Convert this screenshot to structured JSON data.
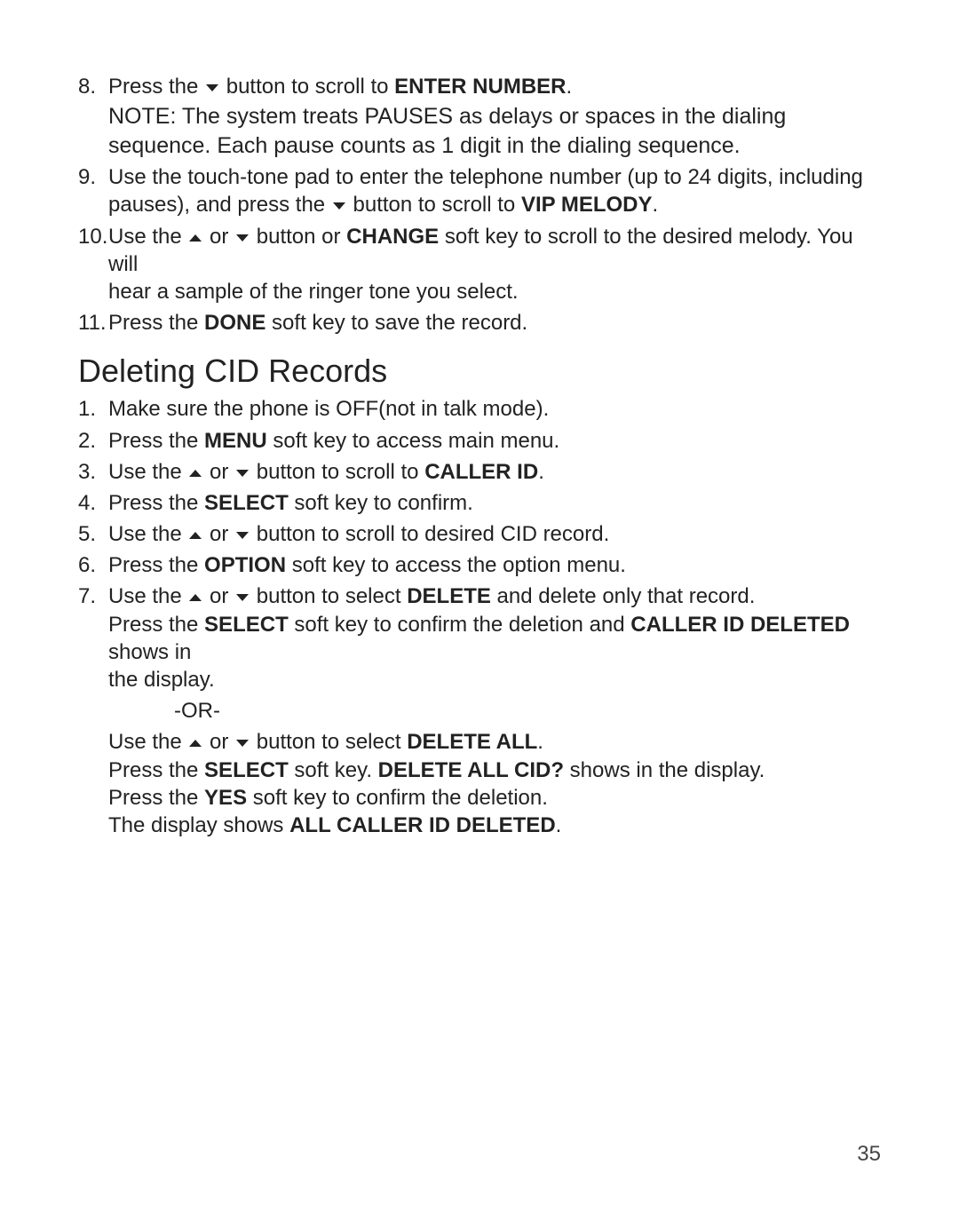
{
  "page_number": "35",
  "top_list": {
    "items": [
      {
        "num": "8.",
        "pre": "Press the ",
        "arrow1": "down",
        "mid": " button to scroll to ",
        "bold1": "ENTER NUMBER",
        "tail": ".",
        "note_a": "NOTE: The system treats PAUSES as delays or spaces in the dialing",
        "note_b": "sequence. Each pause counts as 1 digit in the dialing sequence."
      },
      {
        "num": "9.",
        "line_a_pre": "Use the touch-tone pad to enter the telephone number (up to 24 digits, including",
        "line_b_pre": "pauses), and press the ",
        "line_b_arrow": "down",
        "line_b_mid": " button to scroll to ",
        "line_b_bold": "VIP MELODY",
        "line_b_tail": "."
      },
      {
        "num": "10.",
        "pre": "Use the ",
        "arrow1": "up",
        "mid1": " or ",
        "arrow2": "down",
        "mid2": " button or ",
        "bold1": "CHANGE",
        "tail1": " soft key to scroll to the desired melody. You will",
        "line2": "hear a sample of the ringer tone you select."
      },
      {
        "num": "11.",
        "pre": "Press the ",
        "bold1": "DONE",
        "tail": " soft key to save the record."
      }
    ]
  },
  "heading": "Deleting CID Records",
  "del_list": {
    "items": [
      {
        "num": "1.",
        "pre": "Make sure the phone is ",
        "plain1": "OFF",
        "tail": "(not in talk mode)."
      },
      {
        "num": "2.",
        "pre": "Press the ",
        "bold1": "MENU",
        "tail": " soft key to access main menu."
      },
      {
        "num": "3.",
        "pre": "Use the ",
        "arrow1": "up",
        "mid1": " or ",
        "arrow2": "down",
        "mid2": " button to scroll to ",
        "bold1": "CALLER ID",
        "tail": "."
      },
      {
        "num": "4.",
        "pre": "Press the ",
        "bold1": "SELECT",
        "tail": " soft key to confirm."
      },
      {
        "num": "5.",
        "pre": "Use the ",
        "arrow1": "up",
        "mid1": " or ",
        "arrow2": "down",
        "mid2": " button to scroll to desired CID record."
      },
      {
        "num": "6.",
        "pre": "Press the ",
        "bold1": "OPTION",
        "tail": " soft key to access the option menu."
      },
      {
        "num": "7.",
        "pre": "Use the ",
        "arrow1": "up",
        "mid1": " or ",
        "arrow2": "down",
        "mid2": " button to select ",
        "bold1": "DELETE",
        "tail": " and delete only that record.",
        "line2_pre": "Press the ",
        "line2_bold1": "SELECT",
        "line2_mid": " soft key to confirm the deletion and ",
        "line2_bold2": "CALLER ID DELETED",
        "line2_tail": " shows in",
        "line3": "the display."
      }
    ],
    "or_text": "-OR-",
    "alt": {
      "l1_pre": "Use the ",
      "l1_arrow1": "up",
      "l1_mid1": " or ",
      "l1_arrow2": "down",
      "l1_mid2": " button to select ",
      "l1_bold": "DELETE ALL",
      "l1_tail": ".",
      "l2_pre": "Press the ",
      "l2_bold1": "SELECT",
      "l2_mid": " soft key. ",
      "l2_bold2": "DELETE ALL CID?",
      "l2_tail": " shows in the display.",
      "l3_pre": "Press the ",
      "l3_bold": "YES",
      "l3_tail": " soft key to confirm the deletion.",
      "l4_pre": "The display shows ",
      "l4_bold": "ALL CALLER ID DELETED",
      "l4_tail": "."
    }
  }
}
